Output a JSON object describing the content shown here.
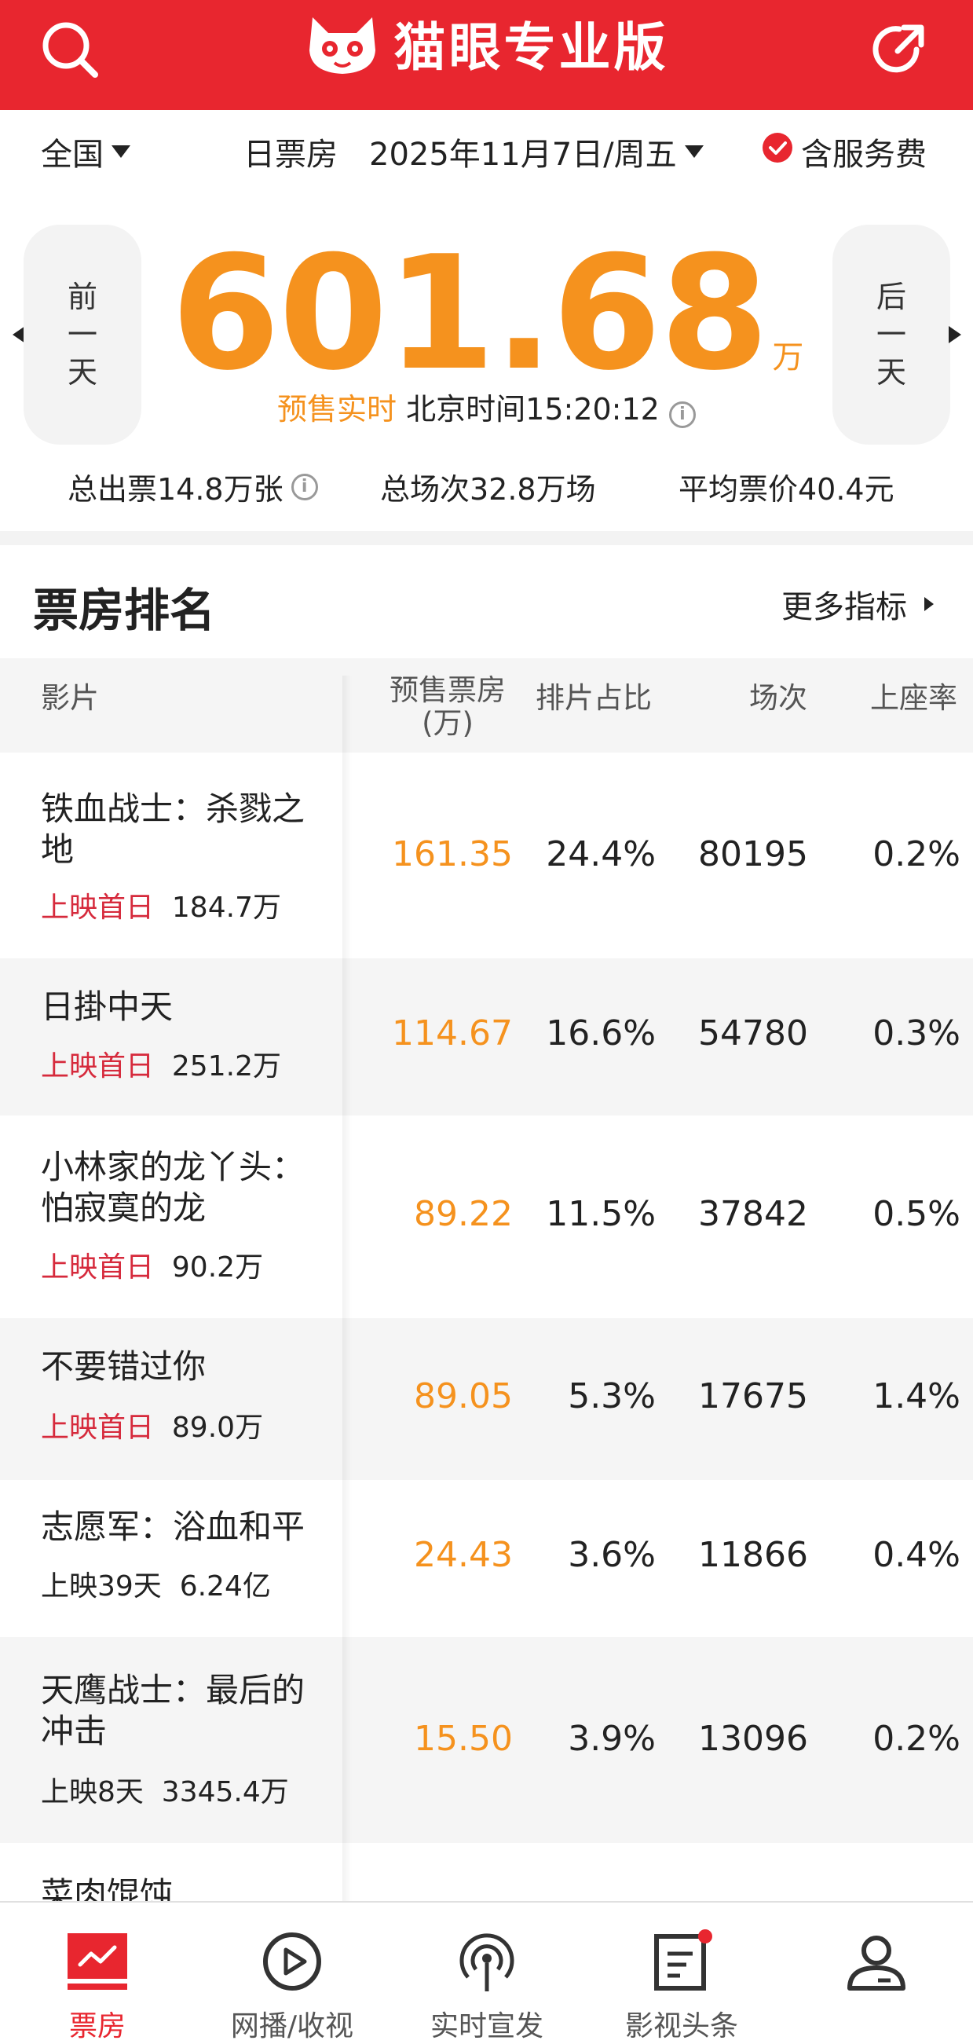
{
  "header": {
    "app_title": "猫眼专业版",
    "colors": {
      "brand": "#e8262f",
      "accent": "#f5921e",
      "red_text": "#d62a3c"
    },
    "left_icon": "search-icon",
    "right_icon": "share-icon"
  },
  "datebar": {
    "region": "全国",
    "type_label": "日票房",
    "date": "2025年11月7日/周五",
    "service_fee": "含服务费"
  },
  "summary": {
    "prev_day": [
      "前",
      "一",
      "天"
    ],
    "next_day": [
      "后",
      "一",
      "天"
    ],
    "total": "601.68",
    "unit": "万",
    "presale_label": "预售实时",
    "time_label": "北京时间",
    "time": "15:20:12",
    "tickets": "总出票14.8万张",
    "shows": "总场次32.8万场",
    "avg_price": "平均票价40.4元"
  },
  "ranking": {
    "title": "票房排名",
    "more": "更多指标",
    "columns": {
      "film": "影片",
      "presale_bo": "预售票房",
      "presale_unit": "(万)",
      "share": "排片占比",
      "shows": "场次",
      "occupancy": "上座率"
    },
    "rows": [
      {
        "title1": "铁血战士：杀戮之",
        "title2": "地",
        "release": "上映首日",
        "total": "184.7万",
        "bo": "161.35",
        "share": "24.4%",
        "shows": "80195",
        "occ": "0.2%"
      },
      {
        "title1": "日掛中天",
        "title2": "",
        "release": "上映首日",
        "total": "251.2万",
        "bo": "114.67",
        "share": "16.6%",
        "shows": "54780",
        "occ": "0.3%"
      },
      {
        "title1": "小林家的龙丫头：",
        "title2": "怕寂寞的龙",
        "release": "上映首日",
        "total": "90.2万",
        "bo": "89.22",
        "share": "11.5%",
        "shows": "37842",
        "occ": "0.5%"
      },
      {
        "title1": "不要错过你",
        "title2": "",
        "release": "上映首日",
        "total": "89.0万",
        "bo": "89.05",
        "share": "5.3%",
        "shows": "17675",
        "occ": "1.4%"
      },
      {
        "title1": "志愿军：浴血和平",
        "title2": "",
        "release": "上映39天",
        "total": "6.24亿",
        "bo": "24.43",
        "share": "3.6%",
        "shows": "11866",
        "occ": "0.4%"
      },
      {
        "title1": "天鹰战士：最后的",
        "title2": "冲击",
        "release": "上映8天",
        "total": "3345.4万",
        "bo": "15.50",
        "share": "3.9%",
        "shows": "13096",
        "occ": "0.2%"
      },
      {
        "title1": "菜肉馄饨",
        "title2": "",
        "release": "",
        "total": "",
        "bo": "",
        "share": "",
        "shows": "",
        "occ": ""
      }
    ]
  },
  "tabs": [
    {
      "label": "票房",
      "icon": "chart-icon"
    },
    {
      "label": "网播/收视",
      "icon": "play-icon"
    },
    {
      "label": "实时宣发",
      "icon": "broadcast-icon"
    },
    {
      "label": "影视头条",
      "icon": "news-icon"
    },
    {
      "label": "",
      "icon": "profile-icon"
    }
  ]
}
